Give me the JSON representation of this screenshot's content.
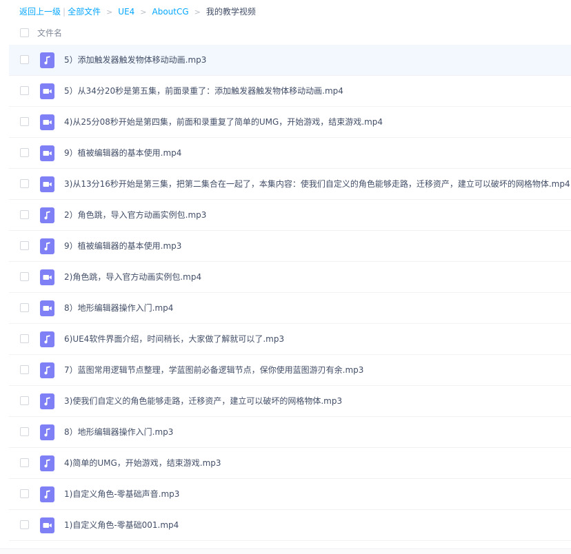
{
  "breadcrumb": {
    "back": "返回上一级",
    "divider": "|",
    "sep": ">",
    "crumbs": [
      "全部文件",
      "UE4",
      "AboutCG"
    ],
    "current": "我的教学视频"
  },
  "list_header": {
    "name_label": "文件名"
  },
  "colors": {
    "link": "#06a7ff",
    "file_icon": "#7f7ff6",
    "row_highlight": "#f2f8fe"
  },
  "files": [
    {
      "name": "5）添加触发器触发物体移动动画.mp3",
      "icon": "audio-file-icon"
    },
    {
      "name": "5）从34分20秒是第五集，前面录重了：添加触发器触发物体移动动画.mp4",
      "icon": "video-file-icon"
    },
    {
      "name": "4)从25分08秒开始是第四集，前面和录重复了简单的UMG，开始游戏，结束游戏.mp4",
      "icon": "video-file-icon"
    },
    {
      "name": "9）植被编辑器的基本使用.mp4",
      "icon": "video-file-icon"
    },
    {
      "name": "3)从13分16秒开始是第三集，把第二集合在一起了，本集内容：使我们自定义的角色能够走路，迁移资产，建立可以破坏的网格物体.mp4",
      "icon": "video-file-icon"
    },
    {
      "name": "2）角色跳，导入官方动画实例包.mp3",
      "icon": "audio-file-icon"
    },
    {
      "name": "9）植被编辑器的基本使用.mp3",
      "icon": "audio-file-icon"
    },
    {
      "name": "2)角色跳，导入官方动画实例包.mp4",
      "icon": "video-file-icon"
    },
    {
      "name": "8）地形编辑器操作入门.mp4",
      "icon": "video-file-icon"
    },
    {
      "name": "6)UE4软件界面介绍，时间稍长，大家做了解就可以了.mp3",
      "icon": "audio-file-icon"
    },
    {
      "name": "7）蓝图常用逻辑节点整理，学蓝图前必备逻辑节点，保你使用蓝图游刃有余.mp3",
      "icon": "audio-file-icon"
    },
    {
      "name": "3)使我们自定义的角色能够走路，迁移资产，建立可以破坏的网格物体.mp3",
      "icon": "audio-file-icon"
    },
    {
      "name": "8）地形编辑器操作入门.mp3",
      "icon": "audio-file-icon"
    },
    {
      "name": "4)简单的UMG，开始游戏，结束游戏.mp3",
      "icon": "audio-file-icon"
    },
    {
      "name": "1)自定义角色-零基础声音.mp3",
      "icon": "audio-file-icon"
    },
    {
      "name": "1)自定义角色-零基础001.mp4",
      "icon": "video-file-icon"
    }
  ]
}
